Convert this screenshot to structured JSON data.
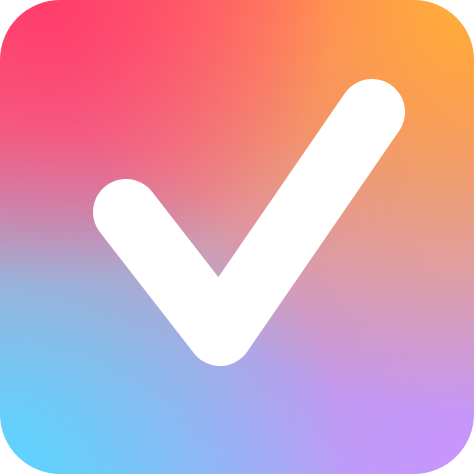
{
  "icon": {
    "name": "checkmark-icon",
    "gradient_colors": {
      "top_left": "#ff3c69",
      "top_right": "#ffb038",
      "bottom_left": "#58d6ff",
      "bottom_right": "#c994ff"
    },
    "check_color": "#ffffff"
  }
}
